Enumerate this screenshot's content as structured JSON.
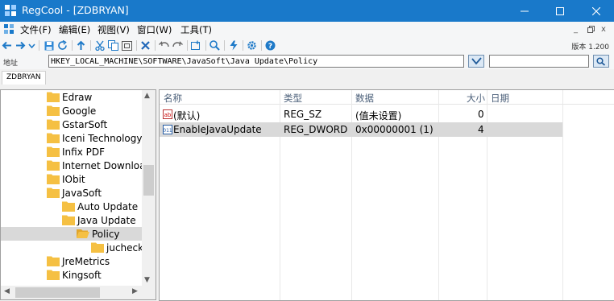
{
  "window": {
    "title": "RegCool - [ZDBRYAN]",
    "controls": {
      "minimize": "minimize",
      "maximize": "maximize",
      "close": "close"
    }
  },
  "menu": {
    "items": [
      "文件(F)",
      "编辑(E)",
      "视图(V)",
      "窗口(W)",
      "工具(T)"
    ],
    "mdi_minimize": "_",
    "mdi_restore": "ᴍ",
    "mdi_close": "x"
  },
  "toolbar": {
    "icons": [
      "back-icon",
      "forward-icon",
      "dropdown-icon",
      "save-icon",
      "refresh-icon",
      "up-icon",
      "cut-icon",
      "copy-icon",
      "paste-icon",
      "delete-icon",
      "undo-icon",
      "redo-icon",
      "new-key-icon",
      "find-icon",
      "bookmark-icon",
      "settings-icon",
      "help-icon"
    ],
    "version": "版本 1.200"
  },
  "address": {
    "label": "地址",
    "path": "HKEY_LOCAL_MACHINE\\SOFTWARE\\JavaSoft\\Java Update\\Policy",
    "search_value": ""
  },
  "computer_tab": "ZDBRYAN",
  "tree": {
    "items": [
      {
        "label": "Edraw",
        "level": 1,
        "selected": false
      },
      {
        "label": "Google",
        "level": 1,
        "selected": false
      },
      {
        "label": "GstarSoft",
        "level": 1,
        "selected": false
      },
      {
        "label": "Iceni Technology",
        "level": 1,
        "selected": false
      },
      {
        "label": "Infix PDF",
        "level": 1,
        "selected": false
      },
      {
        "label": "Internet Downloa",
        "level": 1,
        "selected": false
      },
      {
        "label": "IObit",
        "level": 1,
        "selected": false
      },
      {
        "label": "JavaSoft",
        "level": 1,
        "selected": false
      },
      {
        "label": "Auto Update",
        "level": 2,
        "selected": false
      },
      {
        "label": "Java Update",
        "level": 2,
        "selected": false
      },
      {
        "label": "Policy",
        "level": 3,
        "selected": true
      },
      {
        "label": "jucheck",
        "level": 4,
        "selected": false
      },
      {
        "label": "JreMetrics",
        "level": 1,
        "selected": false
      },
      {
        "label": "Kingsoft",
        "level": 1,
        "selected": false
      }
    ]
  },
  "list": {
    "columns": [
      "名称",
      "类型",
      "数据",
      "大小",
      "日期"
    ],
    "rows": [
      {
        "icon": "string-value-icon",
        "name": "(默认)",
        "type": "REG_SZ",
        "data": "(值未设置)",
        "size": "0",
        "date": "",
        "selected": false
      },
      {
        "icon": "dword-value-icon",
        "name": "EnableJavaUpdate",
        "type": "REG_DWORD",
        "data": "0x00000001 (1)",
        "size": "4",
        "date": "",
        "selected": true
      }
    ]
  },
  "colors": {
    "titlebar": "#1979ca",
    "folder": "#f5c043",
    "selection": "#d9d9d9",
    "header_text": "#4c607a"
  }
}
